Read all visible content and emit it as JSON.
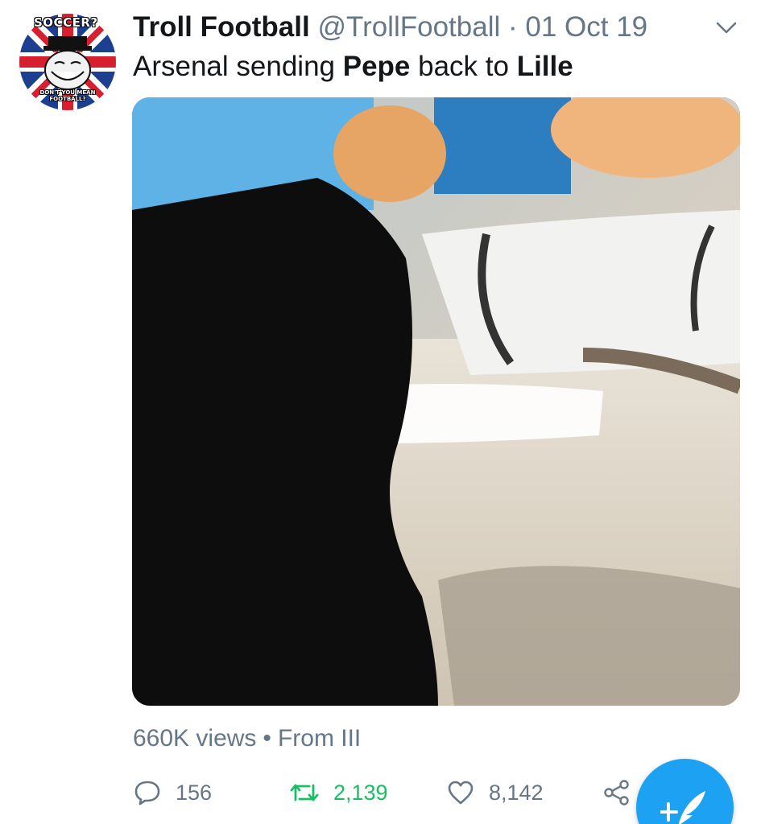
{
  "author": {
    "name": "Troll Football",
    "handle": "@TrollFootball",
    "separator": "·",
    "date": "01 Oct 19",
    "avatar_text_top": "SOCCER?",
    "avatar_text_bottom": "DON'T YOU MEAN FOOTBALL?"
  },
  "tweet": {
    "text_part1": "Arsenal sending ",
    "text_bold1": "Pepe",
    "text_part2": " back to ",
    "text_bold2": "Lille"
  },
  "media": {
    "type": "video",
    "icon": "video-thumbnail"
  },
  "stats": {
    "views": "660K views",
    "separator": "•",
    "source": "From III"
  },
  "actions": {
    "replies": "156",
    "retweets": "2,139",
    "likes": "8,142"
  },
  "colors": {
    "text": "#14171a",
    "secondary": "#657786",
    "retweet_active": "#17bf63",
    "brand_blue": "#1da1f2"
  },
  "icons": {
    "reply": "reply-icon",
    "retweet": "retweet-icon",
    "like": "heart-icon",
    "share": "share-icon",
    "caret": "chevron-down-icon",
    "compose": "compose-tweet-icon"
  }
}
